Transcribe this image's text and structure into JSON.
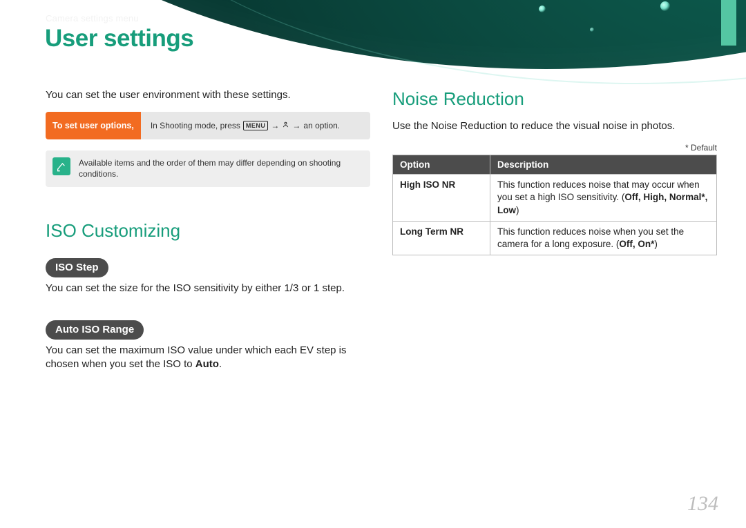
{
  "breadcrumb": "Camera settings menu",
  "page_title": "User settings",
  "intro": "You can set the user environment with these settings.",
  "callout": {
    "label": "To set user options,",
    "pre": "In Shooting mode, press ",
    "menu_icon_label": "MENU",
    "gear_icon_name": "user-settings-icon",
    "post": " an option."
  },
  "note": "Available items and the order of them may differ depending on shooting conditions.",
  "iso_section": {
    "title": "ISO Customizing",
    "step_pill": "ISO Step",
    "step_text": "You can set the size for the ISO sensitivity by either 1/3 or 1 step.",
    "range_pill": "Auto ISO Range",
    "range_text_1": "You can set the maximum ISO value under which each EV step is chosen when you set the ISO to ",
    "range_bold": "Auto",
    "range_text_2": "."
  },
  "nr_section": {
    "title": "Noise Reduction",
    "intro": "Use the Noise Reduction to reduce the visual noise in photos.",
    "default_note": "* Default",
    "headers": {
      "option": "Option",
      "description": "Description"
    },
    "rows": [
      {
        "option": "High ISO NR",
        "desc_1": "This function reduces noise that may occur when you set a high ISO sensitivity. (",
        "opts": "Off, High, Normal*, Low",
        "desc_2": ")"
      },
      {
        "option": "Long Term NR",
        "desc_1": "This function reduces noise when you set the camera for a long exposure. (",
        "opts": "Off, On*",
        "desc_2": ")"
      }
    ]
  },
  "page_number": "134"
}
